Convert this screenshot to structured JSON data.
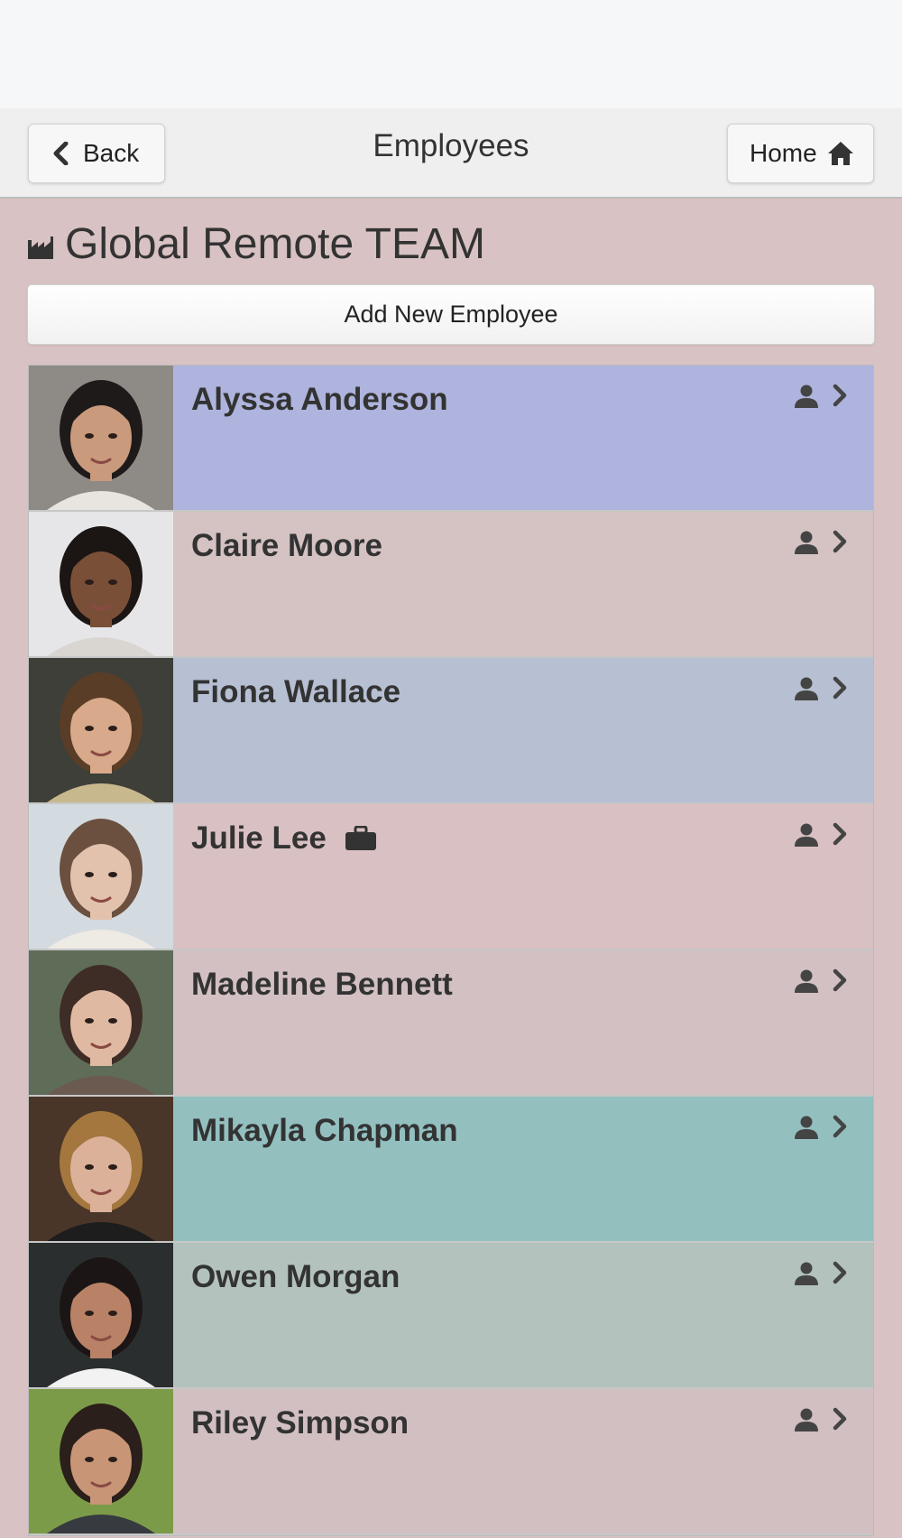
{
  "header": {
    "title": "Employees",
    "back_label": "Back",
    "home_label": "Home"
  },
  "team": {
    "name": "Global Remote TEAM",
    "icon": "factory-icon"
  },
  "add_button_label": "Add New Employee",
  "employees": [
    {
      "name": "Alyssa Anderson",
      "bg": "#aeb4dd",
      "photo": {
        "bg": "#8e8a86",
        "skin": "#c99a7c",
        "hair": "#1e1a1a",
        "shirt": "#e8e4e0"
      }
    },
    {
      "name": "Claire Moore",
      "bg": "#d5c2c3",
      "photo": {
        "bg": "#e6e6e8",
        "skin": "#7a4f38",
        "hair": "#1b1513",
        "shirt": "#d9d6d2"
      }
    },
    {
      "name": "Fiona Wallace",
      "bg": "#b7bfd2",
      "photo": {
        "bg": "#3e3f38",
        "skin": "#d8a98a",
        "hair": "#5a3d26",
        "shirt": "#c8b88e"
      }
    },
    {
      "name": "Julie Lee",
      "bg": "#d9c0c2",
      "badge_icon": "briefcase-icon",
      "photo": {
        "bg": "#d4dbe0",
        "skin": "#e2c1ad",
        "hair": "#6b5040",
        "shirt": "#eeeae4"
      }
    },
    {
      "name": "Madeline Bennett",
      "bg": "#d2c0c2",
      "photo": {
        "bg": "#5f6c58",
        "skin": "#e0b9a2",
        "hair": "#3d2d26",
        "shirt": "#6b5a50"
      }
    },
    {
      "name": "Mikayla Chapman",
      "bg": "#93bfbf",
      "photo": {
        "bg": "#4a3628",
        "skin": "#dcb19a",
        "hair": "#a4773e",
        "shirt": "#1d1d1d"
      }
    },
    {
      "name": "Owen Morgan",
      "bg": "#b3c2bd",
      "photo": {
        "bg": "#2b2e2f",
        "skin": "#b98267",
        "hair": "#1b1615",
        "shirt": "#f2f2f2"
      }
    },
    {
      "name": "Riley Simpson",
      "bg": "#d2bfc2",
      "photo": {
        "bg": "#7c9b48",
        "skin": "#c89577",
        "hair": "#2a1f1a",
        "shirt": "#373a3f"
      }
    }
  ],
  "row_icons": {
    "person": "person-icon",
    "chevron": "chevron-right-icon"
  }
}
